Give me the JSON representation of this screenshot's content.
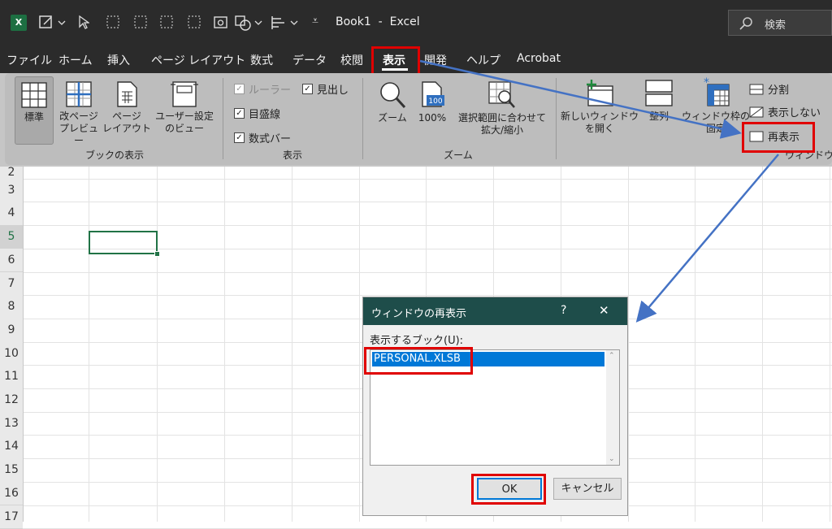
{
  "titlebar": {
    "app_title": "Book1  -  Excel",
    "search_label": "検索"
  },
  "menu": {
    "items": [
      "ファイル",
      "ホーム",
      "挿入",
      "ページ レイアウト",
      "数式",
      "データ",
      "校閲",
      "表示",
      "開発",
      "ヘルプ",
      "Acrobat"
    ]
  },
  "ribbon": {
    "book_view": {
      "label": "ブックの表示",
      "normal": "標準",
      "page_break_1": "改ページ",
      "page_break_2": "プレビュー",
      "page_layout_1": "ページ",
      "page_layout_2": "レイアウト",
      "custom_1": "ユーザー設定",
      "custom_2": "のビュー"
    },
    "show": {
      "label": "表示",
      "ruler": "ルーラー",
      "headings": "見出し",
      "gridlines": "目盛線",
      "formula_bar": "数式バー"
    },
    "zoom": {
      "label": "ズーム",
      "zoom": "ズーム",
      "zoom100": "100%",
      "fit_1": "選択範囲に合わせて",
      "fit_2": "拡大/縮小",
      "badge": "100"
    },
    "window": {
      "label": "ウィンドウ",
      "new_1": "新しいウィンドウ",
      "new_2": "を開く",
      "arrange": "整列",
      "freeze_1": "ウィンドウ枠の",
      "freeze_2": "固定",
      "split": "分割",
      "hide": "表示しない",
      "unhide": "再表示"
    }
  },
  "rows": [
    "2",
    "3",
    "4",
    "5",
    "6",
    "7",
    "8",
    "9",
    "10",
    "11",
    "12",
    "13",
    "14",
    "15",
    "16",
    "17"
  ],
  "dialog": {
    "title": "ウィンドウの再表示",
    "help": "?",
    "close": "✕",
    "list_label": "表示するブック(U):",
    "items": [
      "PERSONAL.XLSB"
    ],
    "ok": "OK",
    "cancel": "キャンセル"
  },
  "colors": {
    "accent_red": "#e00000",
    "arrow_blue": "#4472c4",
    "dialog_title_bg": "#1e4d4a",
    "selection_blue": "#0078d7",
    "selected_cell": "#217346"
  }
}
